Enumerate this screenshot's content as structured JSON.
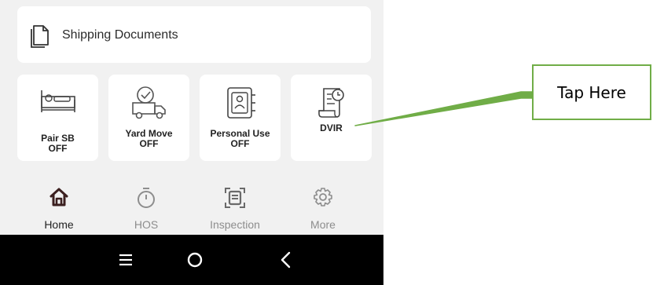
{
  "shipping": {
    "label": "Shipping Documents",
    "icon": "documents-icon"
  },
  "tiles": [
    {
      "line1": "Pair SB",
      "line2": "OFF",
      "icon": "bed-icon"
    },
    {
      "line1": "Yard Move",
      "line2": "OFF",
      "icon": "truck-check-icon"
    },
    {
      "line1": "Personal Use",
      "line2": "OFF",
      "icon": "safe-icon"
    },
    {
      "line1": "DVIR",
      "icon": "scroll-clock-icon"
    }
  ],
  "tabs": [
    {
      "label": "Home",
      "icon": "home-icon",
      "active": true
    },
    {
      "label": "HOS",
      "icon": "stopwatch-icon"
    },
    {
      "label": "Inspection",
      "icon": "inspection-icon"
    },
    {
      "label": "More",
      "icon": "gear-icon"
    }
  ],
  "annotation": {
    "text": "Tap Here",
    "color": "#70ad47"
  },
  "colors": {
    "accent": "#3b1f1f",
    "tab_inactive": "#8d8d8d"
  }
}
